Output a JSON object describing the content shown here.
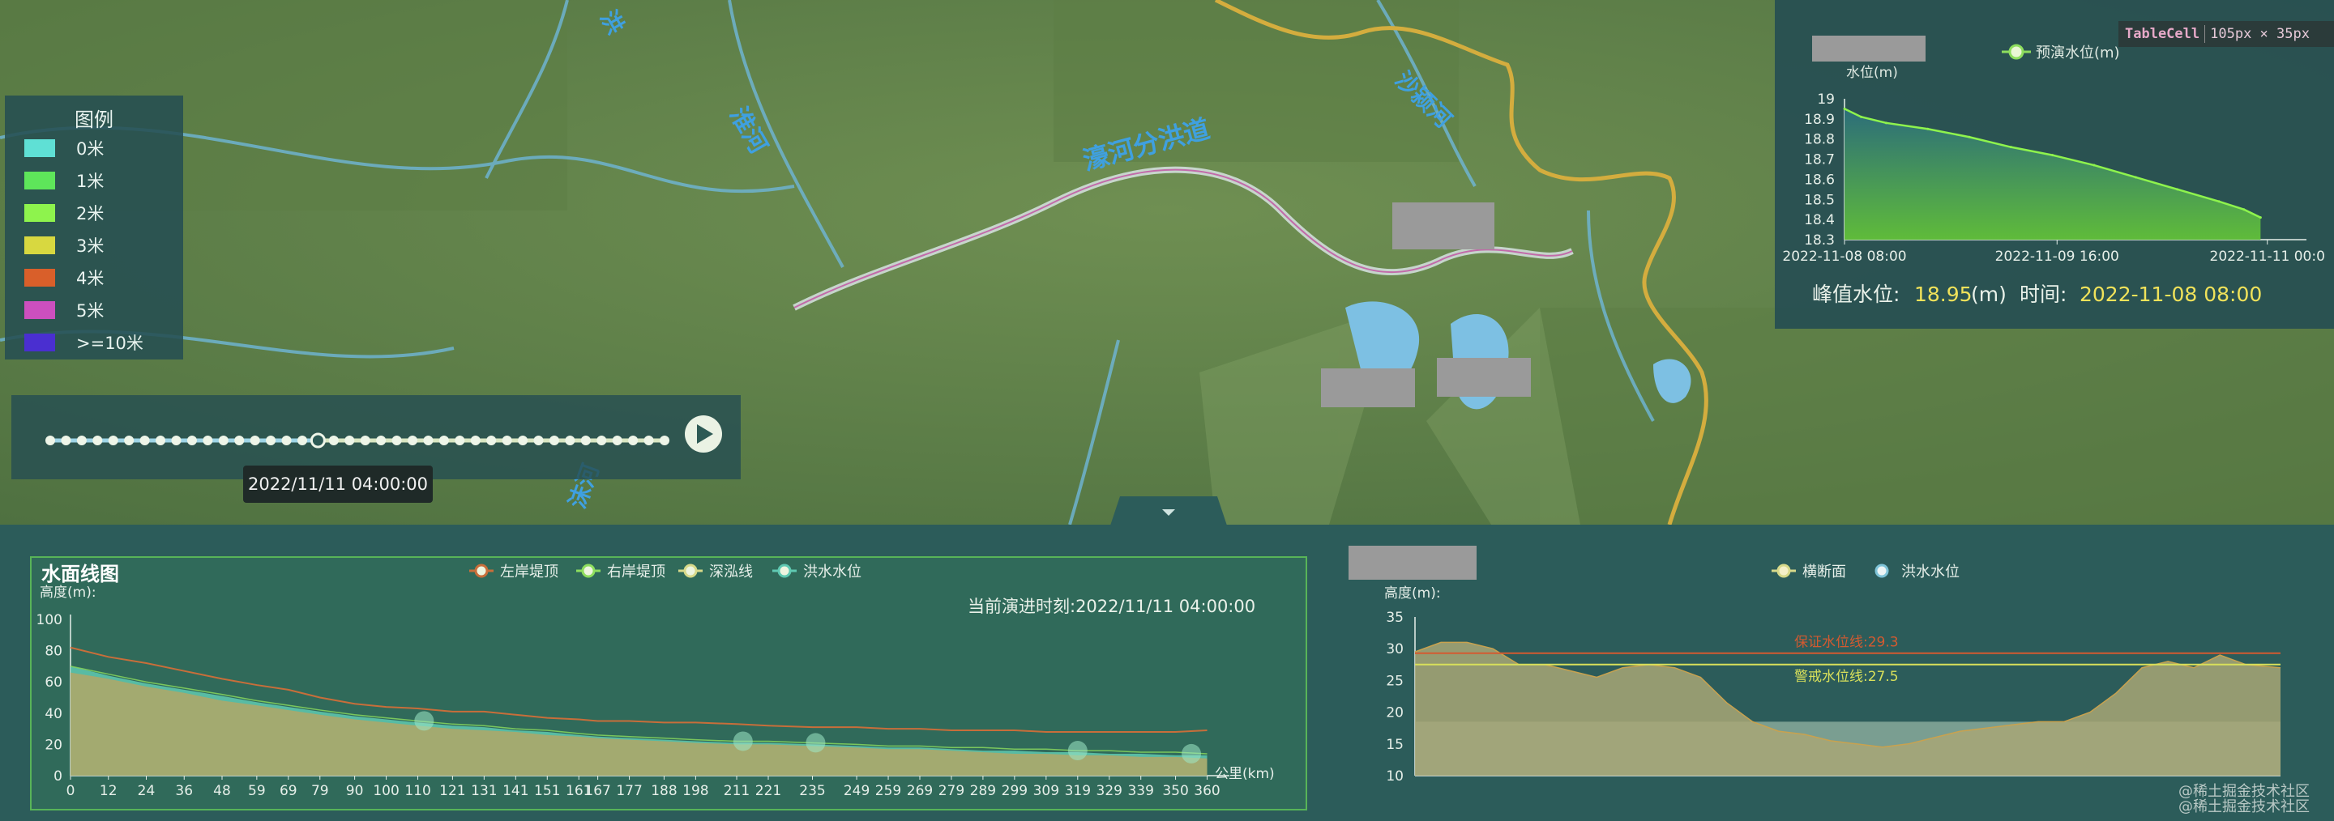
{
  "colors": {
    "left_bank": "#c86e3a",
    "right_bank": "#8ede5e",
    "thalweg": "#d7d98a",
    "flood_level": "#5fc9b2",
    "legend_swatches": [
      "#5fe0d5",
      "#5ee65a",
      "#8ef34d",
      "#d8d840",
      "#d95f2a",
      "#cc4fbe",
      "#4a2fd0"
    ]
  },
  "map": {
    "labels": [
      "淮河",
      "濠河分洪道",
      "沙颍河",
      "沫河",
      "洪"
    ]
  },
  "legend": {
    "title": "图例",
    "items": [
      "0米",
      "1米",
      "2米",
      "3米",
      "4米",
      "5米",
      ">=10米"
    ]
  },
  "timeline": {
    "tooltip": "2022/11/11 04:00:00",
    "total_steps": 40,
    "current_step": 17,
    "play_icon": "play-icon"
  },
  "peak_panel": {
    "legend_label": "预演水位(m)",
    "peak_label": "峰值水位:",
    "peak_value": "18.95",
    "peak_unit": "(m)",
    "time_label": "时间:",
    "time_value": "2022-11-08 08:00",
    "tablecell_name": "TableCell",
    "tablecell_size": "105px × 35px"
  },
  "chart_data": [
    {
      "id": "peak-chart",
      "type": "area",
      "ylabel": "水位(m)",
      "ylim": [
        18.3,
        19
      ],
      "yticks": [
        18.3,
        18.4,
        18.5,
        18.6,
        18.7,
        18.8,
        18.9,
        19
      ],
      "xticks": [
        "2022-11-08 08:00",
        "2022-11-09 16:00",
        "2022-11-11 00:0"
      ],
      "x": [
        0,
        0.04,
        0.1,
        0.2,
        0.3,
        0.4,
        0.5,
        0.6,
        0.7,
        0.8,
        0.9,
        0.96,
        1
      ],
      "series": [
        {
          "name": "预演水位(m)",
          "values": [
            18.95,
            18.91,
            18.88,
            18.85,
            18.81,
            18.76,
            18.72,
            18.67,
            18.61,
            18.55,
            18.49,
            18.45,
            18.41
          ]
        }
      ]
    },
    {
      "id": "water-profile",
      "type": "line",
      "title": "水面线图",
      "ylabel": "高度(m):",
      "xlabel": "公里(km)",
      "ylim": [
        0,
        100
      ],
      "yticks": [
        0,
        20,
        40,
        60,
        80,
        100
      ],
      "xlim": [
        0,
        365
      ],
      "xticks": [
        0,
        12,
        24,
        36,
        48,
        59,
        69,
        79,
        90,
        100,
        110,
        121,
        131,
        141,
        151,
        161,
        167,
        177,
        188,
        198,
        211,
        221,
        235,
        249,
        259,
        269,
        279,
        289,
        299,
        309,
        319,
        329,
        339,
        350,
        360
      ],
      "current_time_text": "当前演进时刻:2022/11/11 04:00:00",
      "x": [
        0,
        12,
        24,
        36,
        48,
        59,
        69,
        79,
        90,
        100,
        110,
        121,
        131,
        141,
        151,
        161,
        167,
        177,
        188,
        198,
        211,
        221,
        235,
        249,
        259,
        269,
        279,
        289,
        299,
        309,
        319,
        329,
        339,
        350,
        360
      ],
      "series": [
        {
          "name": "左岸堤顶",
          "values": [
            82,
            76,
            72,
            67,
            62,
            58,
            55,
            50,
            46,
            44,
            43,
            41,
            41,
            39,
            37,
            36,
            35,
            35,
            34,
            34,
            33,
            32,
            31,
            31,
            30,
            30,
            29,
            29,
            29,
            28,
            28,
            28,
            28,
            28,
            29
          ]
        },
        {
          "name": "右岸堤顶",
          "values": [
            70,
            65,
            60,
            56,
            52,
            48,
            45,
            42,
            39,
            37,
            35,
            33,
            32,
            30,
            29,
            27,
            26,
            25,
            24,
            23,
            22,
            22,
            21,
            20,
            19,
            19,
            18,
            18,
            17,
            17,
            16,
            16,
            15,
            15,
            14
          ]
        },
        {
          "name": "深泓线",
          "values": [
            66,
            62,
            57,
            53,
            48,
            45,
            42,
            39,
            36,
            34,
            32,
            30,
            29,
            28,
            26,
            25,
            24,
            23,
            22,
            21,
            20,
            20,
            19,
            18,
            17,
            17,
            16,
            15,
            14,
            14,
            13,
            13,
            12,
            12,
            11
          ]
        },
        {
          "name": "洪水水位",
          "values": [
            70,
            64,
            59,
            55,
            51,
            47,
            44,
            41,
            38,
            36,
            34,
            32,
            31,
            29,
            28,
            26,
            25,
            24,
            23,
            22,
            21,
            21,
            20,
            19,
            18,
            18,
            17,
            16,
            16,
            15,
            15,
            14,
            14,
            13,
            13
          ]
        }
      ]
    },
    {
      "id": "cross-section",
      "type": "area",
      "ylabel": "高度(m):",
      "ylim": [
        10,
        35
      ],
      "yticks": [
        10,
        15,
        20,
        25,
        30,
        35
      ],
      "x": [
        0,
        0.03,
        0.06,
        0.09,
        0.12,
        0.15,
        0.18,
        0.21,
        0.24,
        0.27,
        0.3,
        0.33,
        0.36,
        0.39,
        0.42,
        0.45,
        0.48,
        0.51,
        0.54,
        0.57,
        0.6,
        0.63,
        0.66,
        0.69,
        0.72,
        0.75,
        0.78,
        0.81,
        0.84,
        0.87,
        0.9,
        0.93,
        0.96,
        1
      ],
      "series": [
        {
          "name": "横断面",
          "values": [
            29.5,
            31,
            31,
            30,
            27.5,
            27.5,
            26.5,
            25.5,
            27,
            27.5,
            27,
            25.5,
            21.5,
            18.5,
            17,
            16.5,
            15.5,
            15,
            14.5,
            15,
            16,
            17,
            17.5,
            18,
            18.5,
            18.5,
            20,
            23,
            27,
            28,
            27,
            29,
            27.5,
            27
          ]
        },
        {
          "name": "洪水水位",
          "values": [
            18.5
          ]
        }
      ],
      "reference_lines": [
        {
          "label": "保证水位线:29.3",
          "value": 29.3,
          "color": "#d35a30"
        },
        {
          "label": "警戒水位线:27.5",
          "value": 27.5,
          "color": "#d8e05a"
        }
      ]
    }
  ],
  "watermarks": [
    "@稀土掘金技术社区",
    "@稀土掘金技术社区"
  ]
}
